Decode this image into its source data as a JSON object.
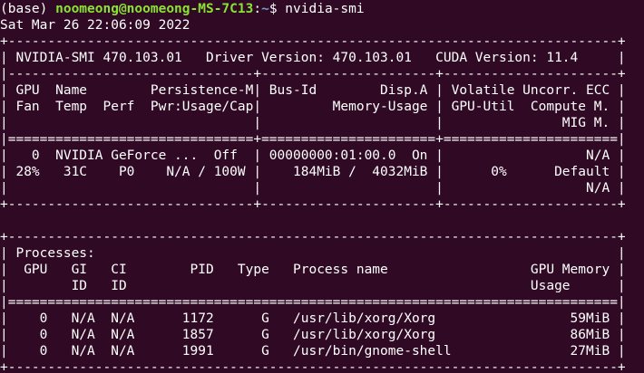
{
  "terminal": {
    "prompt": {
      "env": "(base) ",
      "user_host": "noomeong@noomeong-MS-7C13",
      "colon": ":",
      "path": "~",
      "symbol": "$ ",
      "command": "nvidia-smi"
    },
    "lines": [
      "Sat Mar 26 22:06:09 2022",
      "+-----------------------------------------------------------------------------+",
      "| NVIDIA-SMI 470.103.01   Driver Version: 470.103.01   CUDA Version: 11.4     |",
      "|-------------------------------+----------------------+----------------------+",
      "| GPU  Name        Persistence-M| Bus-Id        Disp.A | Volatile Uncorr. ECC |",
      "| Fan  Temp  Perf  Pwr:Usage/Cap|         Memory-Usage | GPU-Util  Compute M. |",
      "|                               |                      |               MIG M. |",
      "|===============================+======================+======================|",
      "|   0  NVIDIA GeForce ...  Off  | 00000000:01:00.0  On |                  N/A |",
      "| 28%   31C    P0    N/A / 100W |    184MiB /  4032MiB |      0%      Default |",
      "|                               |                      |                  N/A |",
      "+-------------------------------+----------------------+----------------------+",
      "                                                                               ",
      "+-----------------------------------------------------------------------------+",
      "| Processes:                                                                  |",
      "|  GPU   GI   CI        PID   Type   Process name                  GPU Memory |",
      "|        ID   ID                                                   Usage      |",
      "|=============================================================================|",
      "|    0   N/A  N/A      1172      G   /usr/lib/xorg/Xorg                 59MiB |",
      "|    0   N/A  N/A      1857      G   /usr/lib/xorg/Xorg                 86MiB |",
      "|    0   N/A  N/A      1991      G   /usr/bin/gnome-shell               27MiB |",
      "+-----------------------------------------------------------------------------+"
    ]
  }
}
